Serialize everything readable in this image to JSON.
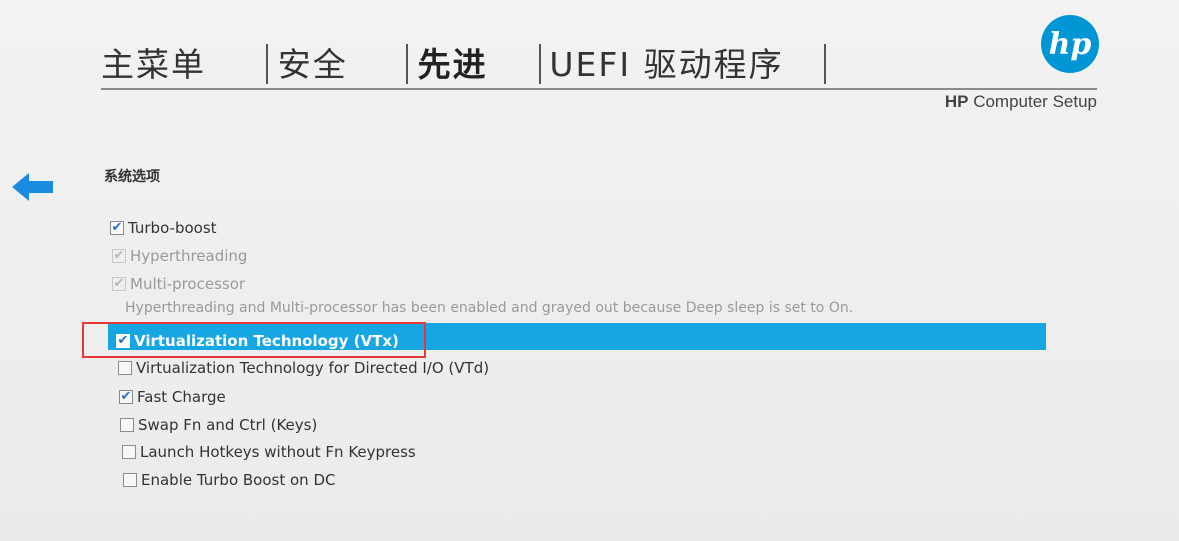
{
  "tabs": [
    {
      "label": "主菜单",
      "active": false
    },
    {
      "label": "安全",
      "active": false
    },
    {
      "label": "先进",
      "active": true
    },
    {
      "label": "UEFI 驱动程序",
      "active": false
    }
  ],
  "brand": {
    "logo_text": "hp",
    "brand_label": "HP",
    "product_label": "Computer Setup",
    "color": "#0096d6"
  },
  "section": {
    "title": "系统选项"
  },
  "options": [
    {
      "label": "Turbo-boost",
      "checked": true,
      "disabled": false,
      "selected": false
    },
    {
      "label": "Hyperthreading",
      "checked": true,
      "disabled": true,
      "selected": false
    },
    {
      "label": "Multi-processor",
      "checked": true,
      "disabled": true,
      "selected": false
    },
    {
      "label": "Virtualization Technology (VTx)",
      "checked": true,
      "disabled": false,
      "selected": true
    },
    {
      "label": "Virtualization Technology for Directed I/O (VTd)",
      "checked": false,
      "disabled": false,
      "selected": false
    },
    {
      "label": "Fast Charge",
      "checked": true,
      "disabled": false,
      "selected": false
    },
    {
      "label": "Swap Fn and Ctrl (Keys)",
      "checked": false,
      "disabled": false,
      "selected": false
    },
    {
      "label": "Launch Hotkeys without Fn Keypress",
      "checked": false,
      "disabled": false,
      "selected": false
    },
    {
      "label": "Enable Turbo Boost on DC",
      "checked": false,
      "disabled": false,
      "selected": false
    }
  ],
  "note": "Hyperthreading and Multi-processor has been enabled and grayed out because Deep sleep is set to On.",
  "icons": {
    "back": "back-arrow-icon",
    "check": "✔"
  },
  "colors": {
    "highlight": "#16a6e3",
    "annotation": "#e53935",
    "accent": "#0096d6"
  }
}
